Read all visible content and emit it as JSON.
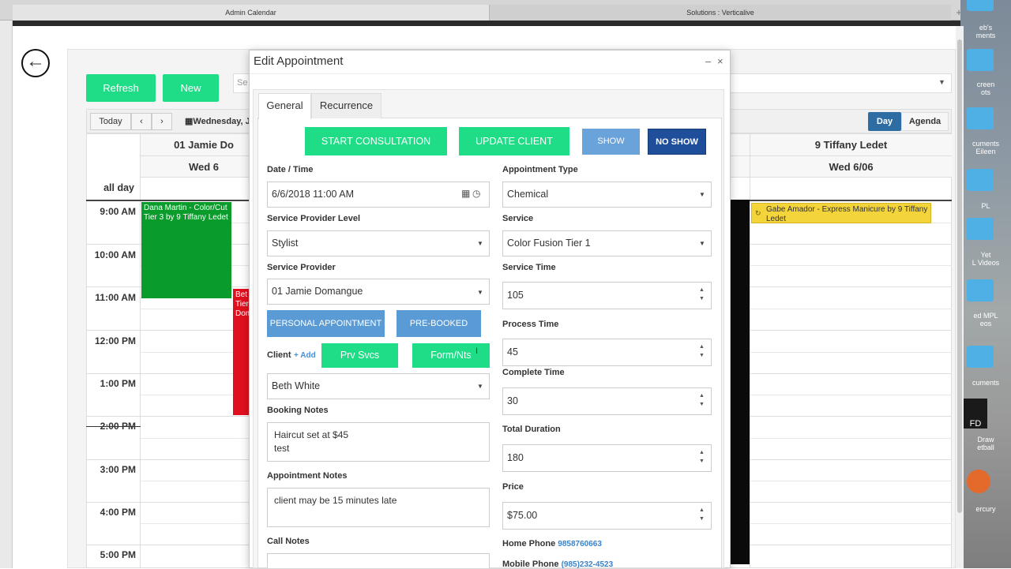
{
  "browser": {
    "tabs": [
      "Admin Calendar",
      "Solutions : Verticalive"
    ],
    "new_tab": "+"
  },
  "desktop": {
    "labels": [
      "eb's\nments",
      "creen\nots",
      "cuments\nEileen",
      "PL",
      "Yet\nL Videos",
      "ed MPL\neos",
      "cuments",
      "Draw\netball",
      "ercury"
    ],
    "fd_label": "FD"
  },
  "toolbar": {
    "refresh": "Refresh",
    "new": "New",
    "search_placeholder": "Se",
    "today": "Today",
    "prev": "‹",
    "next": "›",
    "date_label": "Wednesday, Ju",
    "day_view": "Day",
    "agenda_view": "Agenda"
  },
  "calendar": {
    "columns": [
      {
        "provider": "01 Jamie Do",
        "date": "Wed 6"
      },
      {
        "provider": "9 Tiffany Ledet",
        "date": "Wed 6/06"
      }
    ],
    "all_day": "all day",
    "times": [
      "9:00 AM",
      "10:00 AM",
      "11:00 AM",
      "12:00 PM",
      "1:00 PM",
      "2:00 PM",
      "3:00 PM",
      "4:00 PM",
      "5:00 PM"
    ],
    "events": {
      "green": "Dana Martin - Color/Cut Tier 3 by 9 Tiffany Ledet",
      "red": "Bet Tier Dom",
      "yellow": "Gabe Amador - Express Manicure by 9 Tiffany Ledet"
    }
  },
  "modal": {
    "title": "Edit Appointment",
    "minimize": "–",
    "close": "×",
    "tabs": [
      "General",
      "Recurrence"
    ],
    "actions": {
      "start_consultation": "START CONSULTATION",
      "update_client": "UPDATE CLIENT",
      "show": "SHOW",
      "no_show": "NO SHOW"
    },
    "labels": {
      "date_time": "Date / Time",
      "service_provider_level": "Service Provider Level",
      "service_provider": "Service Provider",
      "client": "Client",
      "add": "+ Add",
      "booking_notes": "Booking Notes",
      "appointment_notes": "Appointment Notes",
      "call_notes": "Call Notes",
      "appointment_type": "Appointment Type",
      "service": "Service",
      "service_time": "Service Time",
      "process_time": "Process Time",
      "complete_time": "Complete Time",
      "total_duration": "Total Duration",
      "price": "Price",
      "home_phone": "Home Phone",
      "mobile_phone": "Mobile Phone"
    },
    "values": {
      "date_time": "6/6/2018 11:00 AM",
      "service_provider_level": "Stylist",
      "service_provider": "01 Jamie Domangue",
      "client": "Beth White",
      "booking_notes_line1": "Haircut set at $45",
      "booking_notes_line2": "test",
      "appointment_notes": "client may be 15 minutes late",
      "call_notes": "",
      "appointment_type": "Chemical",
      "service": "Color Fusion Tier 1",
      "service_time": "105",
      "process_time": "45",
      "complete_time": "30",
      "total_duration": "180",
      "price": "$75.00",
      "home_phone": "9858760663",
      "mobile_phone": "(985)232-4523"
    },
    "buttons": {
      "personal_appointment": "PERSONAL APPOINTMENT",
      "pre_booked": "PRE-BOOKED",
      "prv_svcs": "Prv Svcs",
      "form_nts": "Form/Nts"
    }
  },
  "colors": {
    "green": "#1fdc86",
    "dark_green_event": "#0a9c2b",
    "red_event": "#e0101e",
    "yellow_event": "#f3d43a",
    "blue": "#5b9bd5",
    "navy": "#1f4f9a"
  }
}
